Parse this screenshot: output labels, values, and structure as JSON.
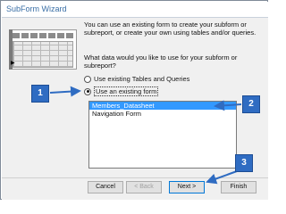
{
  "window": {
    "title": "SubForm Wizard"
  },
  "content": {
    "description": "You can use an existing form to create your subform or subreport, or create your own using tables and/or queries.",
    "question": "What data would you like to use for your subform or subreport?",
    "options": [
      {
        "label": "Use existing Tables and Queries",
        "selected": false
      },
      {
        "label": "Use an existing form",
        "selected": true
      }
    ],
    "forms": [
      {
        "label": "Members_Datasheet",
        "selected": true
      },
      {
        "label": "Navigation Form",
        "selected": false
      }
    ]
  },
  "buttons": {
    "cancel": "Cancel",
    "back": "< Back",
    "next": "Next >",
    "finish": "Finish"
  },
  "callouts": {
    "one": "1",
    "two": "2",
    "three": "3"
  },
  "colors": {
    "callout": "#2f6cc2",
    "selection": "#3399ff",
    "title": "#3a6fa6"
  }
}
